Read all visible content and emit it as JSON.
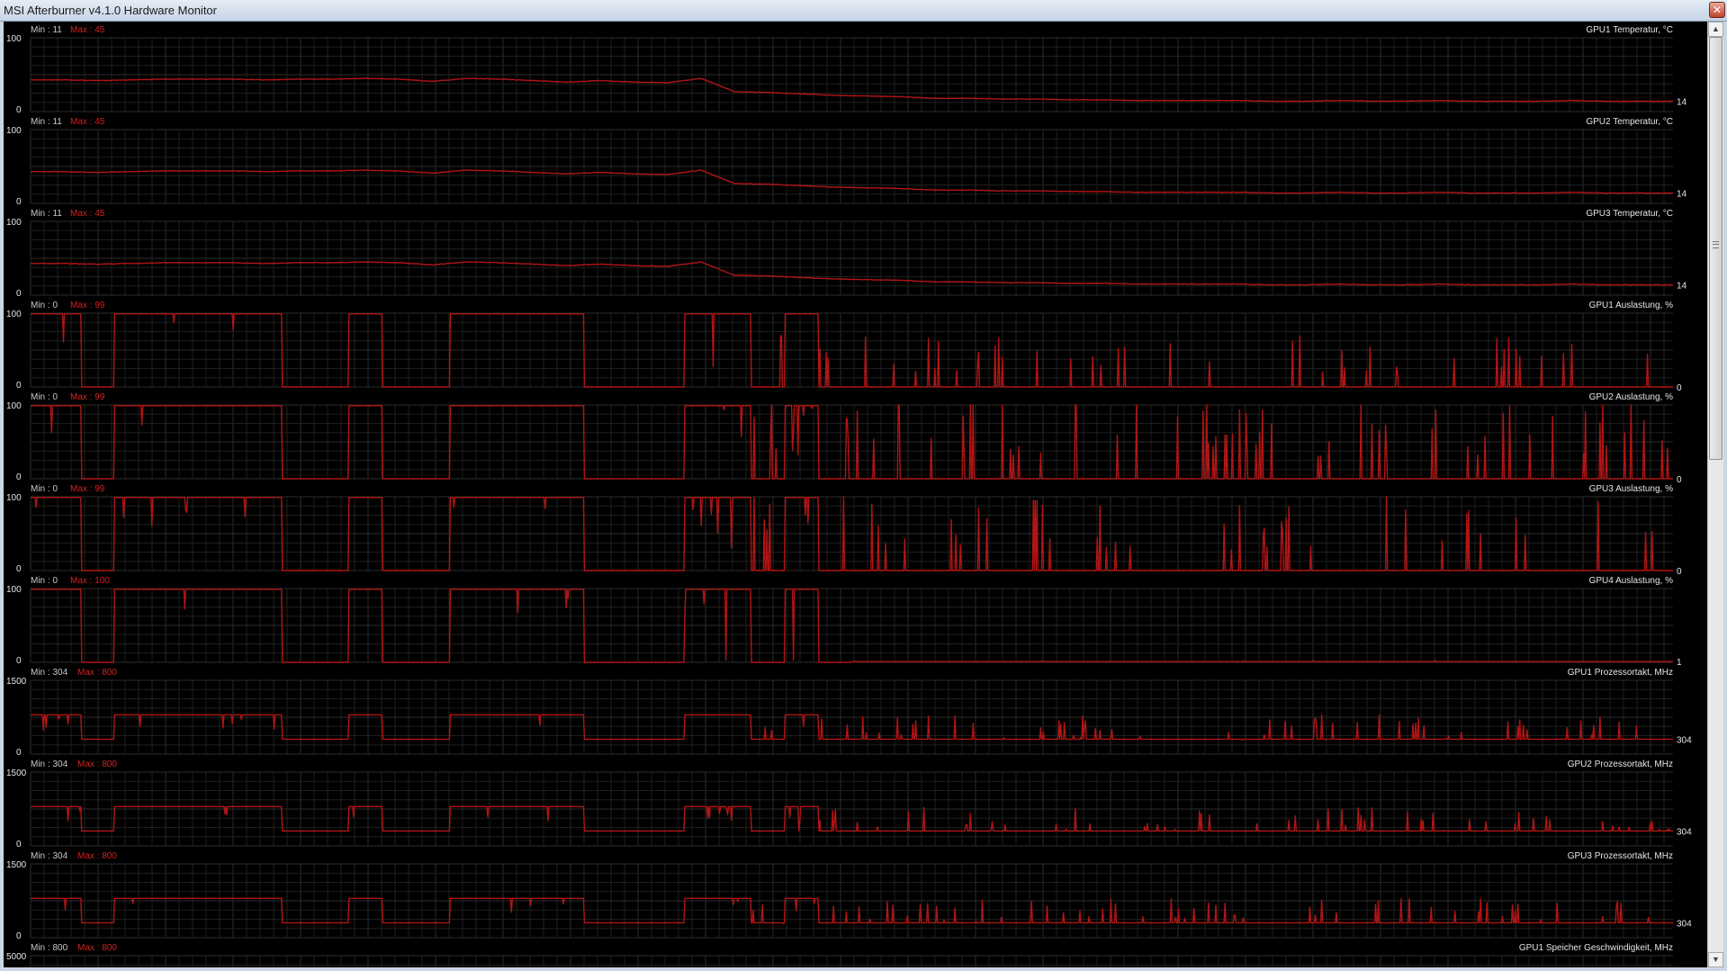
{
  "window": {
    "title": "MSI Afterburner v4.1.0 Hardware Monitor",
    "close_label": "✕"
  },
  "colors": {
    "background": "#000000",
    "grid": "#1f1f1f",
    "grid_major": "#2c2c2c",
    "trace": "#b01515",
    "min_label": "#c8c8c8",
    "max_label": "#d42020",
    "text": "#e6e6e6"
  },
  "chart_data": [
    {
      "type": "line",
      "title": "GPU1 Temperatur, °C",
      "min_text": "Min : 11",
      "max_text": "Max : 45",
      "y_top": "100",
      "y_bottom": "0",
      "ylim": [
        0,
        100
      ],
      "current_value": "14",
      "profile": "temperature",
      "series": [
        {
          "name": "GPU1 Temperatur, °C",
          "values": [
            43,
            43,
            42,
            43,
            44,
            44,
            44,
            43,
            44,
            44,
            45,
            44,
            41,
            45,
            44,
            42,
            40,
            42,
            40,
            39,
            45,
            27,
            26,
            24,
            22,
            21,
            20,
            18,
            18,
            17,
            17,
            16,
            16,
            15,
            15,
            15,
            15,
            14,
            14,
            15,
            14,
            14,
            15,
            14,
            14,
            14,
            15,
            14,
            14,
            14
          ]
        }
      ]
    },
    {
      "type": "line",
      "title": "GPU2 Temperatur, °C",
      "min_text": "Min : 11",
      "max_text": "Max : 45",
      "y_top": "100",
      "y_bottom": "0",
      "ylim": [
        0,
        100
      ],
      "current_value": "14",
      "profile": "temperature",
      "series": [
        {
          "name": "GPU2 Temperatur, °C",
          "values": [
            43,
            43,
            42,
            43,
            44,
            44,
            44,
            43,
            44,
            44,
            45,
            44,
            41,
            45,
            44,
            42,
            40,
            42,
            40,
            39,
            45,
            27,
            26,
            24,
            22,
            21,
            20,
            18,
            18,
            17,
            17,
            16,
            16,
            15,
            15,
            15,
            15,
            14,
            14,
            15,
            14,
            14,
            15,
            14,
            14,
            14,
            15,
            14,
            14,
            14
          ]
        }
      ]
    },
    {
      "type": "line",
      "title": "GPU3 Temperatur, °C",
      "min_text": "Min : 11",
      "max_text": "Max : 45",
      "y_top": "100",
      "y_bottom": "0",
      "ylim": [
        0,
        100
      ],
      "current_value": "14",
      "profile": "temperature",
      "series": [
        {
          "name": "GPU3 Temperatur, °C",
          "values": [
            43,
            43,
            42,
            43,
            44,
            44,
            44,
            43,
            44,
            44,
            45,
            44,
            41,
            45,
            44,
            42,
            40,
            42,
            40,
            39,
            45,
            27,
            26,
            24,
            22,
            21,
            20,
            18,
            18,
            17,
            17,
            16,
            16,
            15,
            15,
            15,
            15,
            14,
            14,
            15,
            14,
            14,
            15,
            14,
            14,
            14,
            15,
            14,
            14,
            14
          ]
        }
      ]
    },
    {
      "type": "line",
      "title": "GPU1 Auslastung, %",
      "min_text": "Min : 0",
      "max_text": "Max : 99",
      "y_top": "100",
      "y_bottom": "0",
      "ylim": [
        0,
        100
      ],
      "current_value": "0",
      "profile": "load",
      "spike_level": 45,
      "spike_density": 0.35,
      "series": [
        {
          "name": "GPU1 Auslastung, %",
          "values": [
            99,
            99,
            0,
            99,
            99,
            99,
            99,
            99,
            0,
            0,
            99,
            0,
            0,
            99,
            99,
            99,
            99,
            0,
            0,
            0,
            99,
            99,
            0,
            99,
            0,
            0,
            0,
            0,
            0,
            0,
            0,
            0,
            0,
            0,
            0,
            0,
            0,
            0,
            0,
            0,
            0,
            0,
            0,
            0,
            0,
            0,
            0,
            0,
            0,
            0
          ]
        }
      ]
    },
    {
      "type": "line",
      "title": "GPU2 Auslastung, %",
      "min_text": "Min : 0",
      "max_text": "Max : 99",
      "y_top": "100",
      "y_bottom": "0",
      "ylim": [
        0,
        100
      ],
      "current_value": "0",
      "profile": "load",
      "spike_level": 70,
      "spike_density": 0.55,
      "series": [
        {
          "name": "GPU2 Auslastung, %",
          "values": [
            99,
            99,
            0,
            99,
            99,
            99,
            99,
            99,
            0,
            0,
            99,
            0,
            0,
            99,
            99,
            99,
            99,
            0,
            0,
            0,
            99,
            99,
            0,
            99,
            0,
            0,
            0,
            0,
            0,
            0,
            0,
            0,
            0,
            0,
            0,
            0,
            0,
            0,
            0,
            0,
            0,
            0,
            0,
            0,
            0,
            0,
            0,
            0,
            0,
            0
          ]
        }
      ]
    },
    {
      "type": "line",
      "title": "GPU3 Auslastung, %",
      "min_text": "Min : 0",
      "max_text": "Max : 99",
      "y_top": "100",
      "y_bottom": "0",
      "ylim": [
        0,
        100
      ],
      "current_value": "0",
      "profile": "load",
      "spike_level": 65,
      "spike_density": 0.5,
      "series": [
        {
          "name": "GPU3 Auslastung, %",
          "values": [
            99,
            99,
            0,
            99,
            99,
            99,
            99,
            99,
            0,
            0,
            99,
            0,
            0,
            99,
            99,
            99,
            99,
            0,
            0,
            0,
            99,
            99,
            0,
            99,
            0,
            0,
            0,
            0,
            0,
            0,
            0,
            0,
            0,
            0,
            0,
            0,
            0,
            0,
            0,
            0,
            0,
            0,
            0,
            0,
            0,
            0,
            0,
            0,
            0,
            0
          ]
        }
      ]
    },
    {
      "type": "line",
      "title": "GPU4 Auslastung, %",
      "min_text": "Min : 0",
      "max_text": "Max : 100",
      "y_top": "100",
      "y_bottom": "0",
      "ylim": [
        0,
        100
      ],
      "current_value": "1",
      "profile": "load",
      "spike_level": 2,
      "spike_density": 0.05,
      "series": [
        {
          "name": "GPU4 Auslastung, %",
          "values": [
            99,
            99,
            0,
            99,
            99,
            99,
            99,
            99,
            0,
            0,
            99,
            0,
            0,
            99,
            99,
            99,
            99,
            0,
            0,
            0,
            99,
            99,
            0,
            99,
            0,
            1,
            1,
            1,
            1,
            1,
            1,
            1,
            1,
            1,
            1,
            1,
            1,
            1,
            1,
            1,
            1,
            1,
            1,
            1,
            1,
            1,
            1,
            1,
            1,
            1
          ]
        }
      ]
    },
    {
      "type": "line",
      "title": "GPU1 Prozessortakt, MHz",
      "min_text": "Min : 304",
      "max_text": "Max : 800",
      "y_top": "1500",
      "y_bottom": "0",
      "ylim": [
        0,
        1500
      ],
      "current_value": "304",
      "profile": "clock",
      "spike_level": 800,
      "spike_density": 0.45,
      "series": [
        {
          "name": "GPU1 Prozessortakt, MHz",
          "values": [
            800,
            800,
            304,
            800,
            800,
            800,
            800,
            800,
            304,
            304,
            800,
            304,
            304,
            800,
            800,
            800,
            800,
            304,
            304,
            304,
            800,
            800,
            304,
            800,
            304,
            304,
            304,
            304,
            304,
            304,
            304,
            304,
            304,
            304,
            304,
            304,
            304,
            304,
            304,
            304,
            304,
            304,
            304,
            304,
            304,
            304,
            304,
            304,
            304,
            304
          ]
        }
      ]
    },
    {
      "type": "line",
      "title": "GPU2 Prozessortakt, MHz",
      "min_text": "Min : 304",
      "max_text": "Max : 800",
      "y_top": "1500",
      "y_bottom": "0",
      "ylim": [
        0,
        1500
      ],
      "current_value": "304",
      "profile": "clock",
      "spike_level": 800,
      "spike_density": 0.55,
      "series": [
        {
          "name": "GPU2 Prozessortakt, MHz",
          "values": [
            800,
            800,
            304,
            800,
            800,
            800,
            800,
            800,
            304,
            304,
            800,
            304,
            304,
            800,
            800,
            800,
            800,
            304,
            304,
            304,
            800,
            800,
            304,
            800,
            304,
            304,
            304,
            304,
            304,
            304,
            304,
            304,
            304,
            304,
            304,
            304,
            304,
            304,
            304,
            304,
            304,
            304,
            304,
            304,
            304,
            304,
            304,
            304,
            304,
            304
          ]
        }
      ]
    },
    {
      "type": "line",
      "title": "GPU3 Prozessortakt, MHz",
      "min_text": "Min : 304",
      "max_text": "Max : 800",
      "y_top": "1500",
      "y_bottom": "0",
      "ylim": [
        0,
        1500
      ],
      "current_value": "304",
      "profile": "clock",
      "spike_level": 800,
      "spike_density": 0.5,
      "series": [
        {
          "name": "GPU3 Prozessortakt, MHz",
          "values": [
            800,
            800,
            304,
            800,
            800,
            800,
            800,
            800,
            304,
            304,
            800,
            304,
            304,
            800,
            800,
            800,
            800,
            304,
            304,
            304,
            800,
            800,
            304,
            800,
            304,
            304,
            304,
            304,
            304,
            304,
            304,
            304,
            304,
            304,
            304,
            304,
            304,
            304,
            304,
            304,
            304,
            304,
            304,
            304,
            304,
            304,
            304,
            304,
            304,
            304
          ]
        }
      ]
    },
    {
      "type": "line",
      "title": "GPU1 Speicher Geschwindigkeit, MHz",
      "min_text": "Min : 800",
      "max_text": "Max : 800",
      "y_top": "5000",
      "y_bottom": "",
      "ylim": [
        0,
        5000
      ],
      "current_value": "",
      "profile": "none",
      "series": [
        {
          "name": "GPU1 Speicher Geschwindigkeit, MHz",
          "values": []
        }
      ]
    }
  ]
}
